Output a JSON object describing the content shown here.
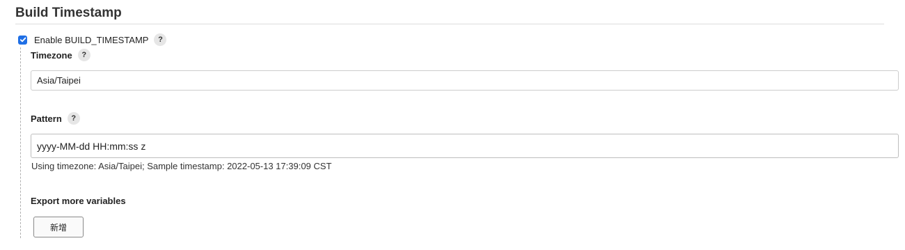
{
  "section": {
    "title": "Build Timestamp"
  },
  "enable": {
    "label": "Enable BUILD_TIMESTAMP",
    "checked": true,
    "help": "?"
  },
  "timezone": {
    "label": "Timezone",
    "help": "?",
    "value": "Asia/Taipei"
  },
  "pattern": {
    "label": "Pattern",
    "help": "?",
    "value": "yyyy-MM-dd HH:mm:ss z",
    "hint": "Using timezone: Asia/Taipei; Sample timestamp: 2022-05-13 17:39:09 CST"
  },
  "export": {
    "label": "Export more variables",
    "add_button": "新增"
  },
  "colors": {
    "checkbox": "#1f6fe5"
  },
  "icons": {
    "checkbox": "check-icon",
    "help": "question-mark-icon"
  }
}
